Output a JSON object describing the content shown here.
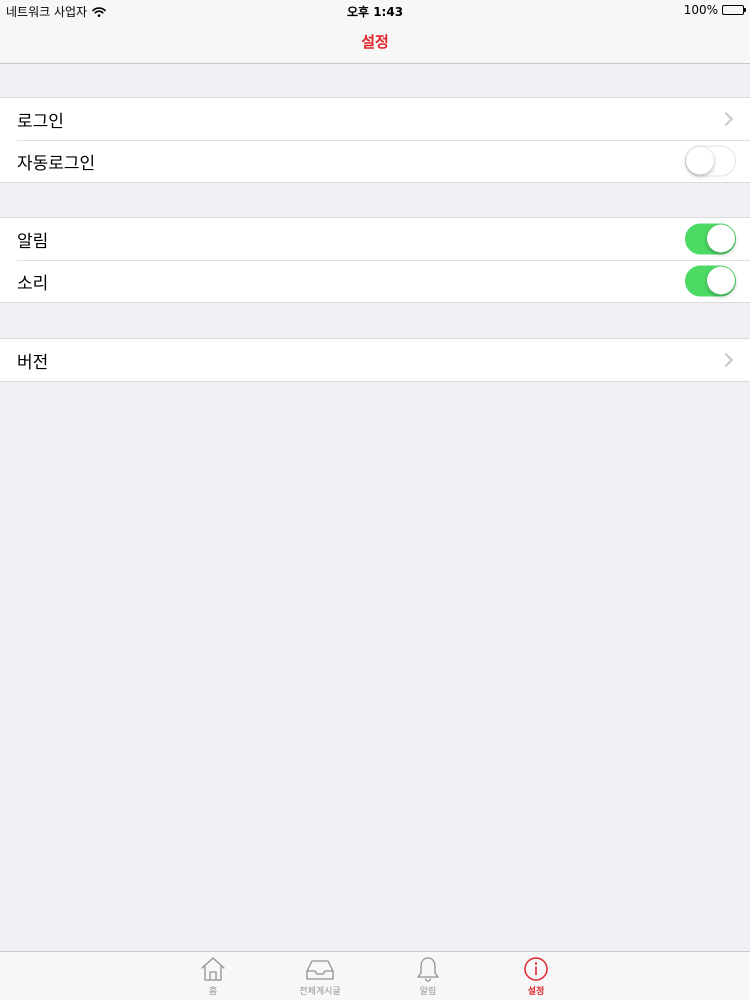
{
  "status_bar": {
    "carrier": "네트워크 사업자",
    "time": "오후 1:43",
    "battery": "100%"
  },
  "nav": {
    "title": "설정"
  },
  "groups": [
    {
      "rows": [
        {
          "label": "로그인",
          "accessory": "chevron"
        },
        {
          "label": "자동로그인",
          "accessory": "toggle",
          "on": false
        }
      ]
    },
    {
      "rows": [
        {
          "label": "알림",
          "accessory": "toggle",
          "on": true
        },
        {
          "label": "소리",
          "accessory": "toggle",
          "on": true
        }
      ]
    },
    {
      "rows": [
        {
          "label": "버전",
          "accessory": "chevron"
        }
      ]
    }
  ],
  "tab_bar": {
    "tabs": [
      {
        "label": "홈",
        "icon": "home-icon",
        "active": false
      },
      {
        "label": "전체게시글",
        "icon": "inbox-icon",
        "active": false
      },
      {
        "label": "알림",
        "icon": "bell-icon",
        "active": false
      },
      {
        "label": "설정",
        "icon": "info-icon",
        "active": true
      }
    ]
  },
  "colors": {
    "accent": "#e0262b",
    "toggle_on": "#4cd964",
    "background": "#efeff4",
    "tab_inactive": "#929292"
  }
}
